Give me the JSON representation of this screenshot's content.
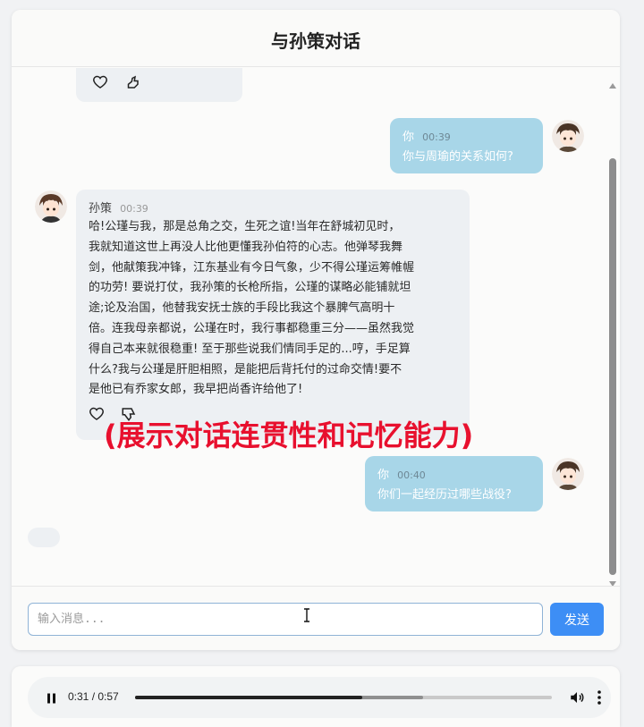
{
  "header": {
    "title": "与孙策对话"
  },
  "messages": [
    {
      "role": "user",
      "sender": "你",
      "time": "00:39",
      "text": "你与周瑜的关系如何?"
    },
    {
      "role": "bot",
      "sender": "孙策",
      "time": "00:39",
      "lines": [
        "哈!公瑾与我，那是总角之交，生死之谊!当年在舒城初见时，",
        "我就知道这世上再没人比他更懂我孙伯符的心志。他弹琴我舞",
        "剑，他献策我冲锋，江东基业有今日气象，少不得公瑾运筹帷幄",
        "的功劳! 要说打仗，我孙策的长枪所指，公瑾的谋略必能铺就坦",
        "途;论及治国，他替我安抚士族的手段比我这个暴脾气高明十",
        "倍。连我母亲都说，公瑾在时，我行事都稳重三分——虽然我觉",
        "得自己本来就很稳重! 至于那些说我们情同手足的...哼，手足算",
        "什么?我与公瑾是肝胆相照，是能把后背托付的过命交情!要不",
        "是他已有乔家女郎，我早把尚香许给他了!"
      ]
    },
    {
      "role": "user",
      "sender": "你",
      "time": "00:40",
      "text": "你们一起经历过哪些战役?"
    }
  ],
  "overlay_caption": "(展示对话连贯性和记忆能力)",
  "input": {
    "placeholder": "输入消息...",
    "value": ""
  },
  "send_button": {
    "label": "发送"
  },
  "audio": {
    "time_text": "0:31 / 0:57",
    "progress": 0.544,
    "buffered": 0.69
  },
  "colors": {
    "accent": "#3d8ef5",
    "user_bubble": "#a8d6e8",
    "bot_bubble": "#edf0f3",
    "caption": "#e8102e"
  },
  "icons": [
    "heart-outline-icon",
    "thumbs-down-icon",
    "play-pause-icon",
    "volume-icon",
    "more-vert-icon",
    "text-cursor-icon"
  ]
}
